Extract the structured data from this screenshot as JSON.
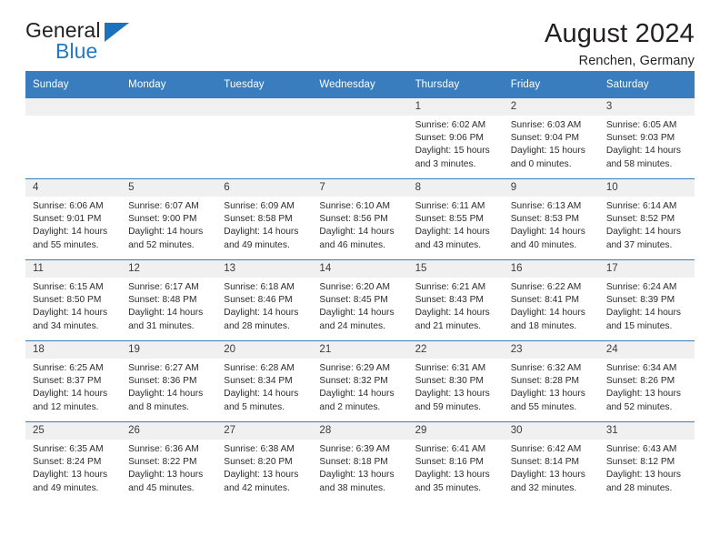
{
  "brand": {
    "name_top": "General",
    "name_bottom": "Blue",
    "accent_color": "#2079c6"
  },
  "header": {
    "title": "August 2024",
    "subtitle": "Renchen, Germany"
  },
  "theme": {
    "header_row_bg": "#3a7dbf",
    "day_band_bg": "#f0f0f0",
    "text_color": "#2b2b2b"
  },
  "weekday_headers": [
    "Sunday",
    "Monday",
    "Tuesday",
    "Wednesday",
    "Thursday",
    "Friday",
    "Saturday"
  ],
  "labels": {
    "sunrise_prefix": "Sunrise:",
    "sunset_prefix": "Sunset:",
    "daylight_prefix": "Daylight:"
  },
  "weeks": [
    [
      {
        "day": "",
        "sunrise": "",
        "sunset": "",
        "daylight": ""
      },
      {
        "day": "",
        "sunrise": "",
        "sunset": "",
        "daylight": ""
      },
      {
        "day": "",
        "sunrise": "",
        "sunset": "",
        "daylight": ""
      },
      {
        "day": "",
        "sunrise": "",
        "sunset": "",
        "daylight": ""
      },
      {
        "day": "1",
        "sunrise": "Sunrise: 6:02 AM",
        "sunset": "Sunset: 9:06 PM",
        "daylight": "Daylight: 15 hours and 3 minutes."
      },
      {
        "day": "2",
        "sunrise": "Sunrise: 6:03 AM",
        "sunset": "Sunset: 9:04 PM",
        "daylight": "Daylight: 15 hours and 0 minutes."
      },
      {
        "day": "3",
        "sunrise": "Sunrise: 6:05 AM",
        "sunset": "Sunset: 9:03 PM",
        "daylight": "Daylight: 14 hours and 58 minutes."
      }
    ],
    [
      {
        "day": "4",
        "sunrise": "Sunrise: 6:06 AM",
        "sunset": "Sunset: 9:01 PM",
        "daylight": "Daylight: 14 hours and 55 minutes."
      },
      {
        "day": "5",
        "sunrise": "Sunrise: 6:07 AM",
        "sunset": "Sunset: 9:00 PM",
        "daylight": "Daylight: 14 hours and 52 minutes."
      },
      {
        "day": "6",
        "sunrise": "Sunrise: 6:09 AM",
        "sunset": "Sunset: 8:58 PM",
        "daylight": "Daylight: 14 hours and 49 minutes."
      },
      {
        "day": "7",
        "sunrise": "Sunrise: 6:10 AM",
        "sunset": "Sunset: 8:56 PM",
        "daylight": "Daylight: 14 hours and 46 minutes."
      },
      {
        "day": "8",
        "sunrise": "Sunrise: 6:11 AM",
        "sunset": "Sunset: 8:55 PM",
        "daylight": "Daylight: 14 hours and 43 minutes."
      },
      {
        "day": "9",
        "sunrise": "Sunrise: 6:13 AM",
        "sunset": "Sunset: 8:53 PM",
        "daylight": "Daylight: 14 hours and 40 minutes."
      },
      {
        "day": "10",
        "sunrise": "Sunrise: 6:14 AM",
        "sunset": "Sunset: 8:52 PM",
        "daylight": "Daylight: 14 hours and 37 minutes."
      }
    ],
    [
      {
        "day": "11",
        "sunrise": "Sunrise: 6:15 AM",
        "sunset": "Sunset: 8:50 PM",
        "daylight": "Daylight: 14 hours and 34 minutes."
      },
      {
        "day": "12",
        "sunrise": "Sunrise: 6:17 AM",
        "sunset": "Sunset: 8:48 PM",
        "daylight": "Daylight: 14 hours and 31 minutes."
      },
      {
        "day": "13",
        "sunrise": "Sunrise: 6:18 AM",
        "sunset": "Sunset: 8:46 PM",
        "daylight": "Daylight: 14 hours and 28 minutes."
      },
      {
        "day": "14",
        "sunrise": "Sunrise: 6:20 AM",
        "sunset": "Sunset: 8:45 PM",
        "daylight": "Daylight: 14 hours and 24 minutes."
      },
      {
        "day": "15",
        "sunrise": "Sunrise: 6:21 AM",
        "sunset": "Sunset: 8:43 PM",
        "daylight": "Daylight: 14 hours and 21 minutes."
      },
      {
        "day": "16",
        "sunrise": "Sunrise: 6:22 AM",
        "sunset": "Sunset: 8:41 PM",
        "daylight": "Daylight: 14 hours and 18 minutes."
      },
      {
        "day": "17",
        "sunrise": "Sunrise: 6:24 AM",
        "sunset": "Sunset: 8:39 PM",
        "daylight": "Daylight: 14 hours and 15 minutes."
      }
    ],
    [
      {
        "day": "18",
        "sunrise": "Sunrise: 6:25 AM",
        "sunset": "Sunset: 8:37 PM",
        "daylight": "Daylight: 14 hours and 12 minutes."
      },
      {
        "day": "19",
        "sunrise": "Sunrise: 6:27 AM",
        "sunset": "Sunset: 8:36 PM",
        "daylight": "Daylight: 14 hours and 8 minutes."
      },
      {
        "day": "20",
        "sunrise": "Sunrise: 6:28 AM",
        "sunset": "Sunset: 8:34 PM",
        "daylight": "Daylight: 14 hours and 5 minutes."
      },
      {
        "day": "21",
        "sunrise": "Sunrise: 6:29 AM",
        "sunset": "Sunset: 8:32 PM",
        "daylight": "Daylight: 14 hours and 2 minutes."
      },
      {
        "day": "22",
        "sunrise": "Sunrise: 6:31 AM",
        "sunset": "Sunset: 8:30 PM",
        "daylight": "Daylight: 13 hours and 59 minutes."
      },
      {
        "day": "23",
        "sunrise": "Sunrise: 6:32 AM",
        "sunset": "Sunset: 8:28 PM",
        "daylight": "Daylight: 13 hours and 55 minutes."
      },
      {
        "day": "24",
        "sunrise": "Sunrise: 6:34 AM",
        "sunset": "Sunset: 8:26 PM",
        "daylight": "Daylight: 13 hours and 52 minutes."
      }
    ],
    [
      {
        "day": "25",
        "sunrise": "Sunrise: 6:35 AM",
        "sunset": "Sunset: 8:24 PM",
        "daylight": "Daylight: 13 hours and 49 minutes."
      },
      {
        "day": "26",
        "sunrise": "Sunrise: 6:36 AM",
        "sunset": "Sunset: 8:22 PM",
        "daylight": "Daylight: 13 hours and 45 minutes."
      },
      {
        "day": "27",
        "sunrise": "Sunrise: 6:38 AM",
        "sunset": "Sunset: 8:20 PM",
        "daylight": "Daylight: 13 hours and 42 minutes."
      },
      {
        "day": "28",
        "sunrise": "Sunrise: 6:39 AM",
        "sunset": "Sunset: 8:18 PM",
        "daylight": "Daylight: 13 hours and 38 minutes."
      },
      {
        "day": "29",
        "sunrise": "Sunrise: 6:41 AM",
        "sunset": "Sunset: 8:16 PM",
        "daylight": "Daylight: 13 hours and 35 minutes."
      },
      {
        "day": "30",
        "sunrise": "Sunrise: 6:42 AM",
        "sunset": "Sunset: 8:14 PM",
        "daylight": "Daylight: 13 hours and 32 minutes."
      },
      {
        "day": "31",
        "sunrise": "Sunrise: 6:43 AM",
        "sunset": "Sunset: 8:12 PM",
        "daylight": "Daylight: 13 hours and 28 minutes."
      }
    ]
  ]
}
